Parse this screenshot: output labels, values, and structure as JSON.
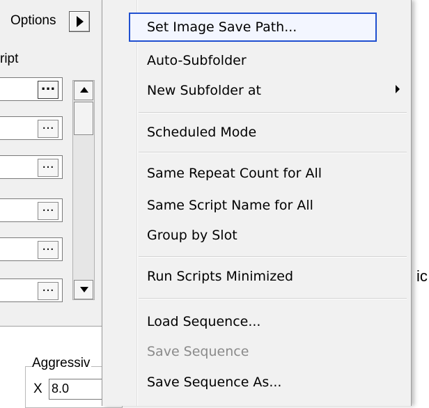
{
  "dialog": {
    "options_label": "Options",
    "script_header": "ript",
    "browse_label": "...",
    "aggressive_label": "Aggressiv",
    "x_label": "X",
    "x_value": "8.0",
    "cut_text": "ic"
  },
  "menu": {
    "items": [
      {
        "label": "Set Image Save Path..."
      },
      {
        "label": "Auto-Subfolder"
      },
      {
        "label": "New Subfolder at"
      },
      {
        "label": "Scheduled Mode"
      },
      {
        "label": "Same Repeat Count for All"
      },
      {
        "label": "Same Script Name for All"
      },
      {
        "label": "Group by Slot"
      },
      {
        "label": "Run Scripts Minimized"
      },
      {
        "label": "Load Sequence..."
      },
      {
        "label": "Save Sequence"
      },
      {
        "label": "Save Sequence As..."
      }
    ]
  },
  "colors": {
    "highlight_border": "#1f4fd0",
    "disabled_text": "#8a8a8a"
  }
}
